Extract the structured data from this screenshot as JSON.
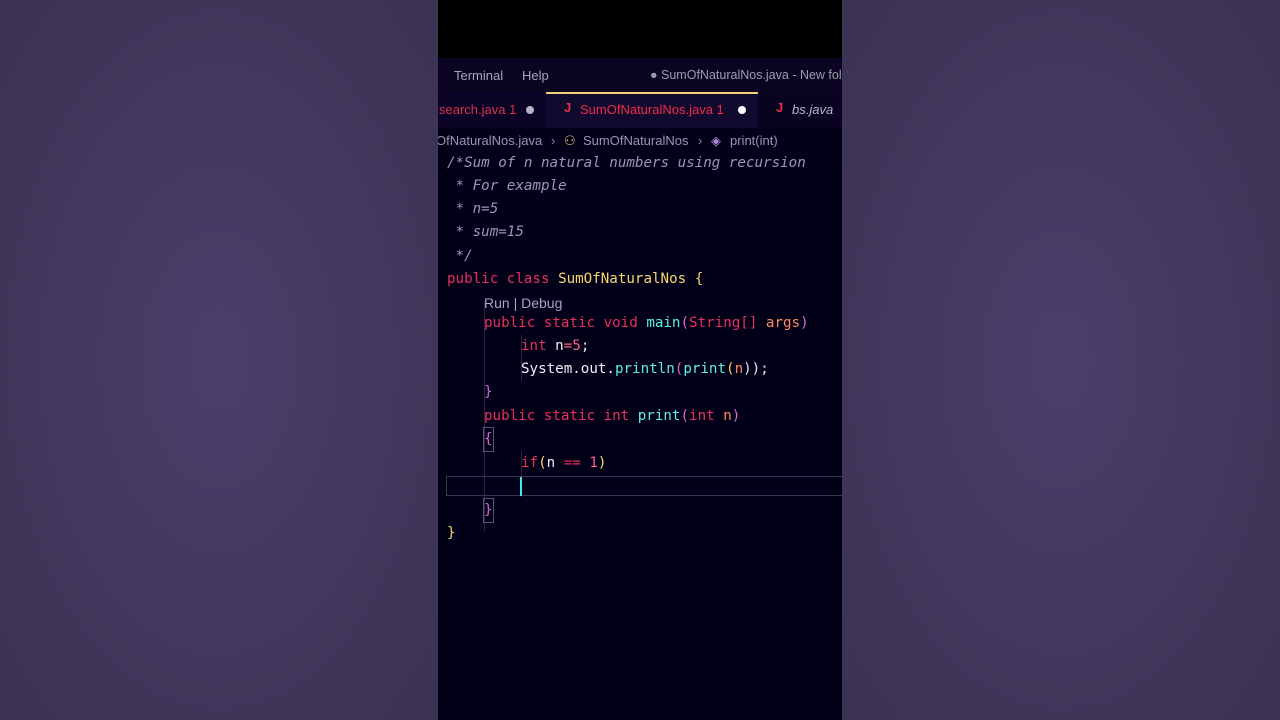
{
  "menu": {
    "terminal": "Terminal",
    "help": "Help",
    "window_title": "● SumOfNaturalNos.java - New fol"
  },
  "tabs": [
    {
      "label": "search.java 1",
      "modified": true,
      "italic": false
    },
    {
      "label": "SumOfNaturalNos.java 1",
      "modified": true,
      "active": true
    },
    {
      "label": "bs.java",
      "italic": true
    }
  ],
  "breadcrumb": {
    "file": "OfNaturalNos.java",
    "class": "SumOfNaturalNos",
    "method": "print(int)"
  },
  "codelens": "Run | Debug",
  "code": {
    "l1": "/*Sum of n natural numbers using recursion",
    "l2": " * For example",
    "l3": " * n=5",
    "l4": " * sum=15",
    "l5": " */",
    "class_kw1": "public",
    "class_kw2": "class",
    "class_name": "SumOfNaturalNos",
    "open_brace": "{",
    "main_kw1": "public",
    "main_kw2": "static",
    "main_kw3": "void",
    "main_name": "main",
    "main_open": "(",
    "main_type": "String[]",
    "main_param": "args",
    "main_close": ")",
    "int_kw": "int",
    "n_decl": "n",
    "assign": "=",
    "five": "5",
    "semi": ";",
    "sys": "System.out.",
    "println": "println",
    "p_open": "(",
    "print_call": "print",
    "p_open2": "(",
    "n_arg": "n",
    "p_close": "));",
    "close_main": "}",
    "print_kw1": "public",
    "print_kw2": "static",
    "print_kw3": "int",
    "print_name": "print",
    "print_open": "(",
    "print_type": "int",
    "print_param": "n",
    "print_close": ")",
    "method_open": "{",
    "if_kw": "if",
    "if_open": "(",
    "if_n": "n",
    "if_op": "==",
    "if_one": "1",
    "if_close": ")",
    "method_close": "}",
    "class_close": "}"
  },
  "colors": {
    "active_tab_border": "#f2d17a",
    "cursor": "#44e8f0"
  }
}
